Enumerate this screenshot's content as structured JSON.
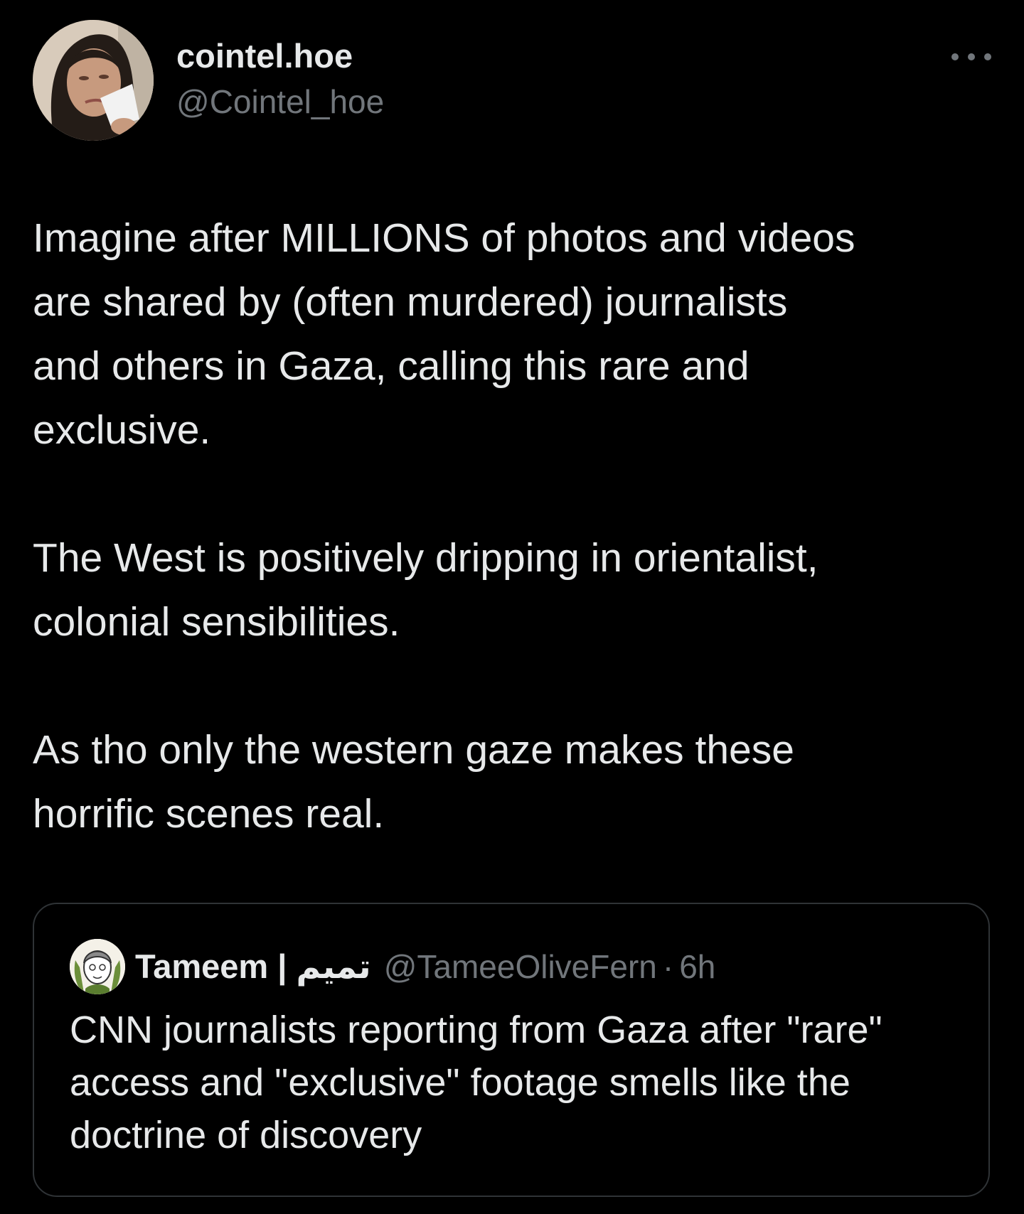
{
  "tweet": {
    "author": {
      "display_name": "cointel.hoe",
      "handle": "@Cointel_hoe",
      "avatar": "profile-photo"
    },
    "more_icon": "more-horizontal-icon",
    "paragraphs": [
      "Imagine after MILLIONS of photos and videos\nare shared by (often murdered) journalists\nand others in Gaza, calling this rare and\nexclusive.",
      "The West is positively dripping in orientalist,\ncolonial sensibilities.",
      "As tho only the western gaze makes these\nhorrific scenes real."
    ]
  },
  "quoted_tweet": {
    "author": {
      "display_name": "Tameem | تميم",
      "handle": "@TameeOliveFern",
      "avatar": "profile-illustration"
    },
    "separator": "·",
    "time": "6h",
    "text": "CNN journalists reporting from Gaza after \"rare\"\naccess and \"exclusive\" footage smells like the\ndoctrine of discovery"
  },
  "colors": {
    "background": "#000000",
    "primary_text": "#e7e9ea",
    "secondary_text": "#71767b",
    "border": "#2f3336"
  }
}
